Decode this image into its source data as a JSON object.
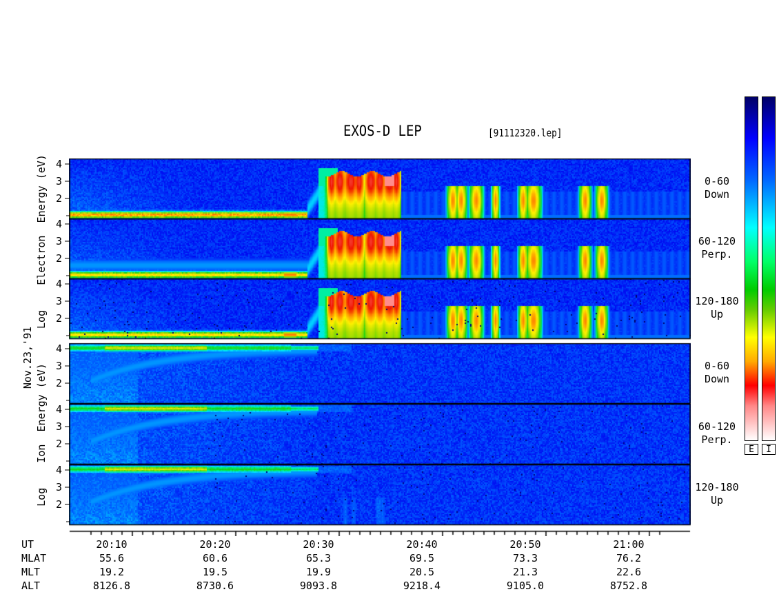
{
  "title": "EXOS-D LEP",
  "file": "[91112320.lep]",
  "date_label": "Nov.23,'91",
  "colorbar_labels": [
    "E",
    "I"
  ],
  "groups": [
    {
      "name": "electron",
      "label_words": [
        "Log",
        "Electron",
        "Energy",
        "(eV)"
      ]
    },
    {
      "name": "ion",
      "label_words": [
        "Log",
        "Ion",
        "Energy",
        "(eV)"
      ]
    }
  ],
  "panels": [
    {
      "id": "e-down",
      "angle": "0-60",
      "dir": "Down"
    },
    {
      "id": "e-perp",
      "angle": "60-120",
      "dir": "Perp."
    },
    {
      "id": "e-up",
      "angle": "120-180",
      "dir": "Up"
    },
    {
      "id": "i-down",
      "angle": "0-60",
      "dir": "Down"
    },
    {
      "id": "i-perp",
      "angle": "60-120",
      "dir": "Perp."
    },
    {
      "id": "i-up",
      "angle": "120-180",
      "dir": "Up"
    }
  ],
  "ephemeris": {
    "row_labels": [
      "UT",
      "MLAT",
      "MLT",
      "ALT"
    ],
    "ticks": [
      "20:10",
      "20:20",
      "20:30",
      "20:40",
      "20:50",
      "21:00"
    ],
    "mlat": [
      "55.6",
      "60.6",
      "65.3",
      "69.5",
      "73.3",
      "76.2"
    ],
    "mlt": [
      "19.2",
      "19.5",
      "19.9",
      "20.5",
      "21.3",
      "22.6"
    ],
    "alt": [
      "8126.8",
      "8730.6",
      "9093.8",
      "9218.4",
      "9105.0",
      "8752.8"
    ]
  },
  "chart_data": {
    "type": "heatmap",
    "title": "EXOS-D LEP",
    "xlabel": "UT",
    "ylabel": "Log Energy (eV)",
    "x_ticks": [
      "20:10",
      "20:20",
      "20:30",
      "20:40",
      "20:50",
      "21:00"
    ],
    "x_range_minutes": [
      20.0,
      21.6
    ],
    "y_ticks": [
      1,
      2,
      3,
      4
    ],
    "y_range": [
      1,
      4
    ],
    "log_y": true,
    "series": [
      {
        "name": "Electron 0-60 Down"
      },
      {
        "name": "Electron 60-120 Perp."
      },
      {
        "name": "Electron 120-180 Up"
      },
      {
        "name": "Ion 0-60 Down"
      },
      {
        "name": "Ion 60-120 Perp."
      },
      {
        "name": "Ion 120-180 Up"
      }
    ],
    "colormap": [
      "#ffffff",
      "#ff0000",
      "#ffaa00",
      "#ffff00",
      "#00cc00",
      "#00ffff",
      "#0000ff",
      "#000066"
    ]
  }
}
